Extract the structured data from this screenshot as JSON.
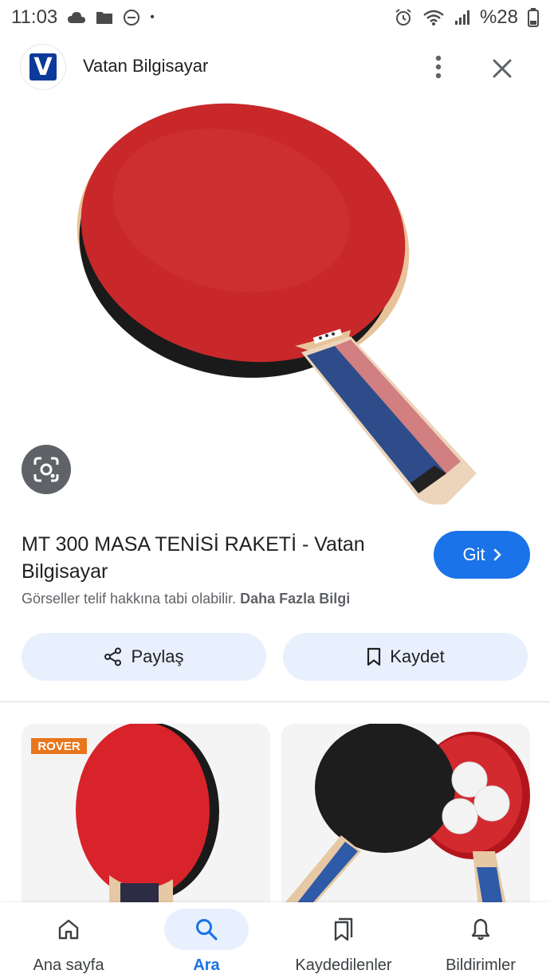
{
  "status_bar": {
    "time": "11:03",
    "battery": "%28",
    "dot": "•"
  },
  "header": {
    "site_name": "Vatan Bilgisayar",
    "logo_letter": "V"
  },
  "result": {
    "title": "MT 300 MASA TENİSİ RAKETİ - Vatan Bilgisayar",
    "go_label": "Git",
    "copyright_text": "Görseller telif hakkına tabi olabilir.",
    "more_info_label": "Daha Fazla Bilgi"
  },
  "actions": {
    "share_label": "Paylaş",
    "save_label": "Kaydet"
  },
  "related": {
    "thumb1_brand": "ROVER"
  },
  "bottom_nav": {
    "items": [
      {
        "label": "Ana sayfa",
        "icon": "home-icon"
      },
      {
        "label": "Ara",
        "icon": "search-icon",
        "active": true
      },
      {
        "label": "Kaydedilenler",
        "icon": "bookmarks-icon"
      },
      {
        "label": "Bildirimler",
        "icon": "bell-icon"
      }
    ]
  },
  "colors": {
    "accent": "#1a73e8",
    "chip_bg": "#e8f0fe",
    "racket_red": "#c8282a",
    "logo_blue": "#0b3a9a"
  }
}
